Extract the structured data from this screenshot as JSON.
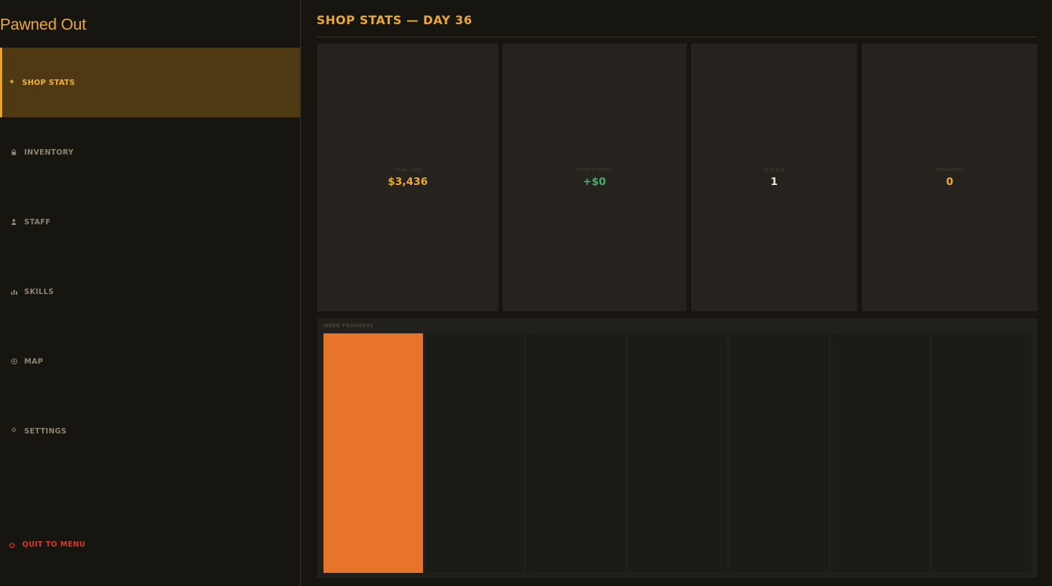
{
  "app": {
    "title": "Pawned Out"
  },
  "sidebar": {
    "items": [
      {
        "label": "SHOP STATS",
        "icon": "star-icon",
        "glyph": "★",
        "active": true
      },
      {
        "label": "INVENTORY",
        "icon": "lock-icon",
        "glyph": "🔒",
        "active": false
      },
      {
        "label": "STAFF",
        "icon": "person-icon",
        "glyph": "👤",
        "active": false
      },
      {
        "label": "SKILLS",
        "icon": "bar-chart-icon",
        "glyph": "▮",
        "active": false
      },
      {
        "label": "MAP",
        "icon": "compass-icon",
        "glyph": "◎",
        "active": false
      },
      {
        "label": "SETTINGS",
        "icon": "gear-icon",
        "glyph": "⚙",
        "active": false
      }
    ],
    "quit": {
      "label": "QUIT TO MENU",
      "icon": "power-icon",
      "glyph": "⏻"
    }
  },
  "main": {
    "title": "SHOP STATS — DAY 36",
    "stats": [
      {
        "label": "TOTAL CASH",
        "value": "$3,436",
        "color": "#e8a933"
      },
      {
        "label": "TODAY'S PROFIT",
        "value": "+$0",
        "color": "#3fae6a"
      },
      {
        "label": "IN STOCK",
        "value": "1",
        "color": "#ece6d6"
      },
      {
        "label": "REPUTATION",
        "value": "0",
        "color": "#e8a933"
      }
    ],
    "week": {
      "label": "WEEK PROGRESS",
      "days": [
        1,
        0,
        0,
        0,
        0,
        0,
        0
      ],
      "fill_color": "#e8742a"
    }
  },
  "colors": {
    "accent": "#e8a933",
    "active_bg": "#4e3913",
    "danger": "#d7392b",
    "profit": "#3fae6a",
    "progress": "#e8742a"
  }
}
